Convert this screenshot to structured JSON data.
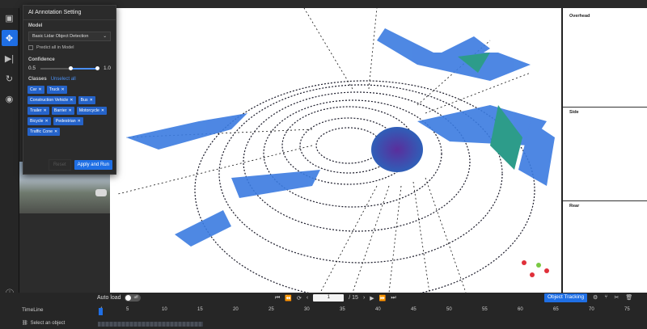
{
  "ai_panel": {
    "title": "AI Annotation Setting",
    "model_label": "Model",
    "model_value": "Basic Lidar Object Detection",
    "predict_all": "Predict all in Model",
    "confidence_label": "Confidence",
    "conf_min": "0.5",
    "conf_max": "1.0",
    "classes_label": "Classes",
    "unselect_all": "Unselect all",
    "classes": [
      "Car",
      "Truck",
      "Construction Vehicle",
      "Bus",
      "Trailer",
      "Barrier",
      "Motorcycle",
      "Bicycle",
      "Pedestrian",
      "Traffic Cone"
    ],
    "reset_label": "Reset",
    "apply_label": "Apply and Run"
  },
  "right_panel": {
    "overhead": "Overhead",
    "side": "Side",
    "rear": "Rear"
  },
  "bottom": {
    "auto_load": "Auto load",
    "toggle_state": "off",
    "frame_value": "1",
    "frame_total": "/ 15",
    "object_tracking": "Object Tracking",
    "timeline_label": "TimeLine",
    "select_object": "Select an object",
    "ticks": [
      "1",
      "5",
      "10",
      "15",
      "20",
      "25",
      "30",
      "35",
      "40",
      "45",
      "50",
      "55",
      "60",
      "65",
      "70",
      "75"
    ]
  },
  "colors": {
    "accent": "#1f6fe5",
    "tag": "#2563c9",
    "panel": "#2b2b2b"
  }
}
